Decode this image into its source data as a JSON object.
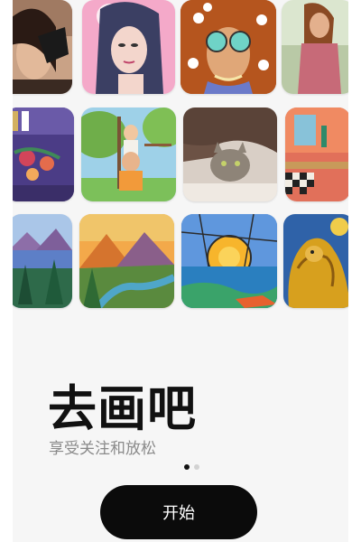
{
  "onboarding": {
    "title": "去画吧",
    "subtitle": "享受关注和放松",
    "start_button_label": "开始",
    "page_indicator": {
      "current": 1,
      "total": 2
    }
  },
  "gallery": {
    "rows": [
      [
        "woman-portrait",
        "anime-girl-portrait",
        "woman-sunglasses-flowers",
        "woman-dress"
      ],
      [
        "bookshelf-flowers",
        "kids-playground",
        "cat-under-blanket",
        "interior-table"
      ],
      [
        "lake-landscape",
        "mountain-sunset-river",
        "stained-glass-sunset",
        "golden-lion"
      ]
    ]
  },
  "colors": {
    "accent": "#0b0b0b",
    "title": "#111111",
    "subtitle": "#8a8a8a",
    "background": "#f6f6f6"
  }
}
